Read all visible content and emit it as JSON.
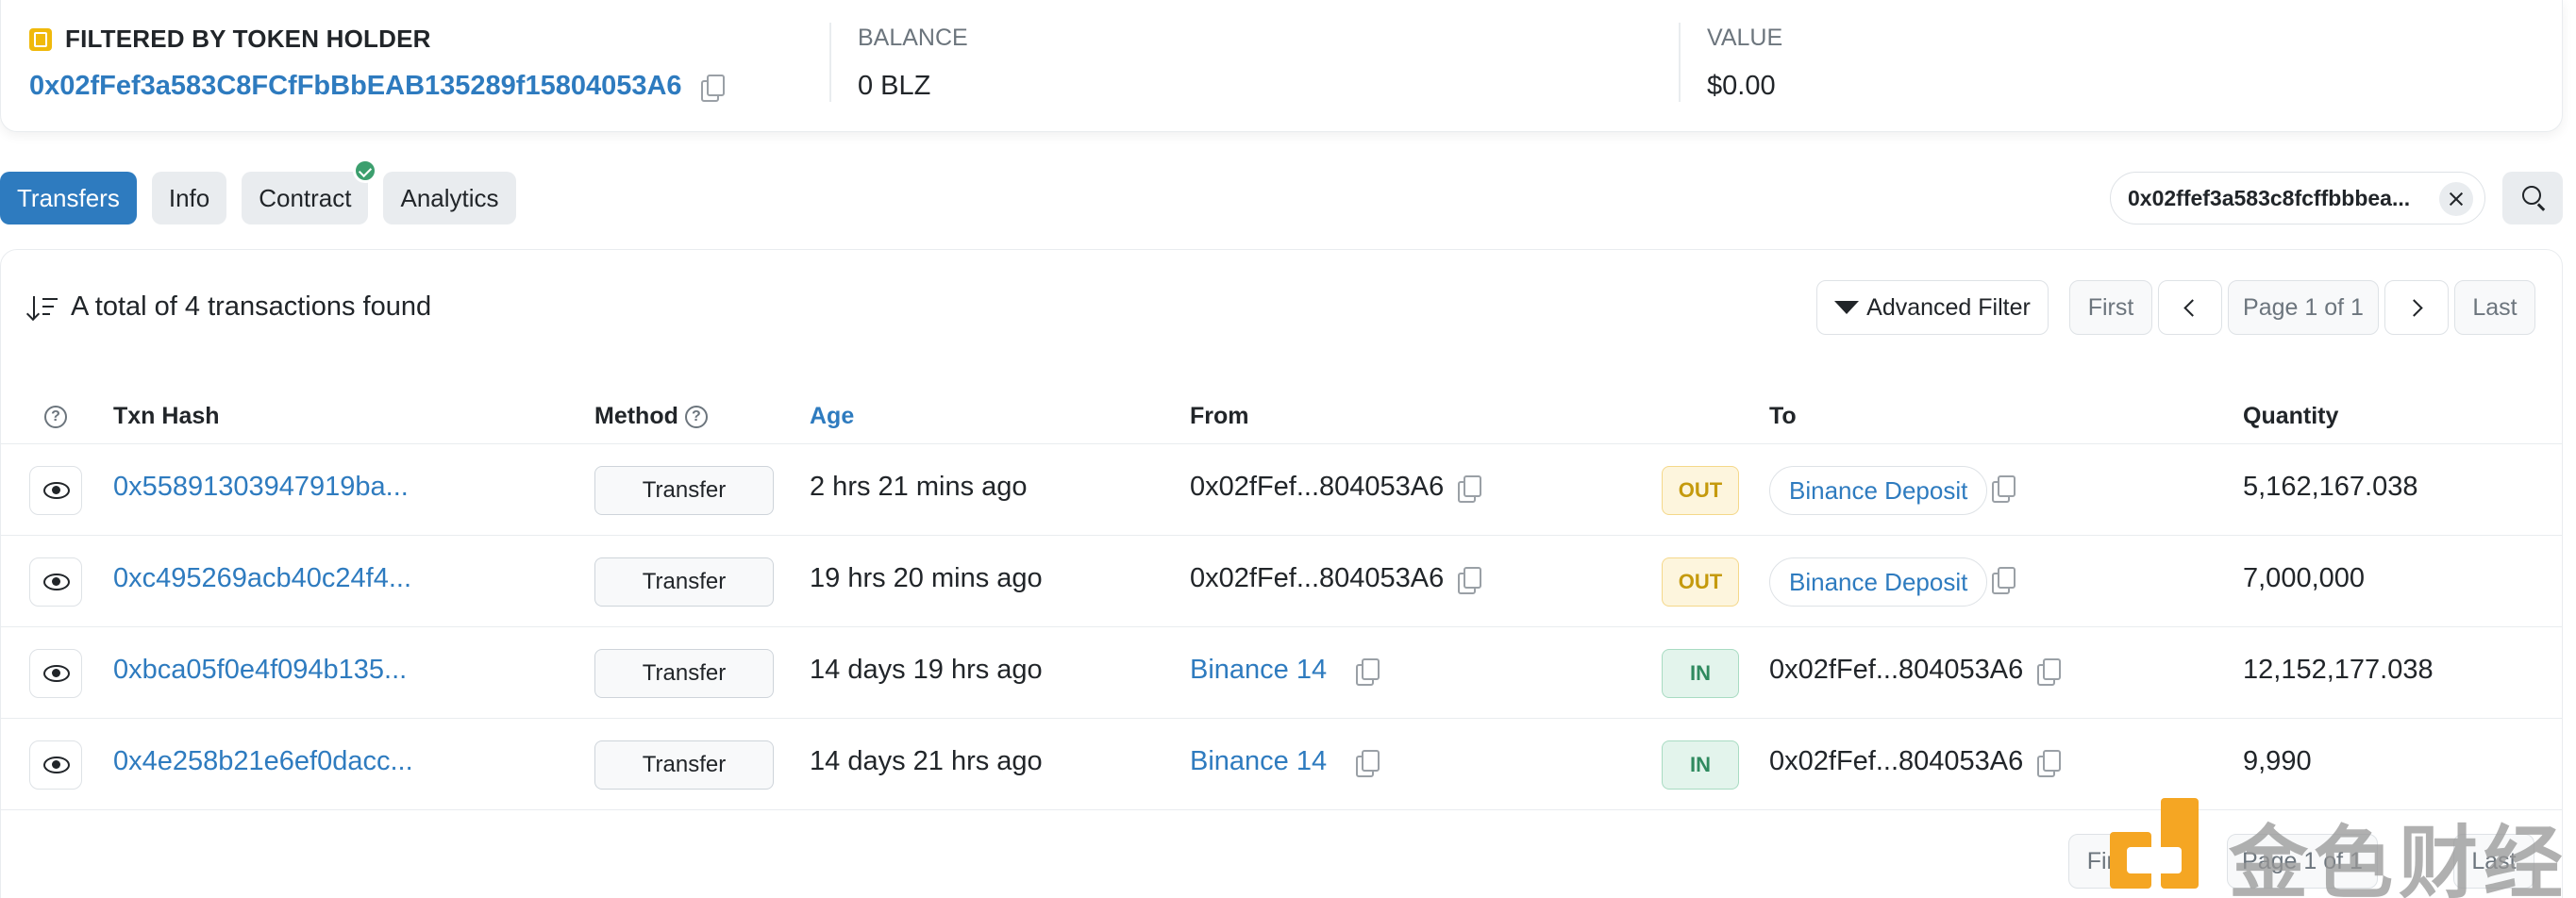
{
  "summary": {
    "holder_label": "FILTERED BY TOKEN HOLDER",
    "holder_address": "0x02fFef3a583C8FCfFbBbEAB135289f15804053A6",
    "balance_label": "BALANCE",
    "balance_value": "0 BLZ",
    "value_label": "VALUE",
    "value_value": "$0.00"
  },
  "tabs": [
    {
      "label": "Transfers",
      "active": true
    },
    {
      "label": "Info",
      "active": false
    },
    {
      "label": "Contract",
      "active": false
    },
    {
      "label": "Analytics",
      "active": false
    }
  ],
  "search_chip": {
    "text": "0x02ffef3a583c8fcffbbbea..."
  },
  "toolbar": {
    "total_text": "A total of 4 transactions found",
    "advanced_filter": "Advanced Filter",
    "first": "First",
    "page": "Page 1 of 1",
    "last": "Last"
  },
  "table": {
    "headers": {
      "help": "?",
      "txn_hash": "Txn Hash",
      "method": "Method",
      "age": "Age",
      "from": "From",
      "to": "To",
      "quantity": "Quantity"
    },
    "rows": [
      {
        "hash": "0x55891303947919ba...",
        "method": "Transfer",
        "age": "2 hrs 21 mins ago",
        "from": "0x02fFef...804053A6",
        "dir": "OUT",
        "to": "Binance Deposit",
        "quantity": "5,162,167.038"
      },
      {
        "hash": "0xc495269acb40c24f4...",
        "method": "Transfer",
        "age": "19 hrs 20 mins ago",
        "from": "0x02fFef...804053A6",
        "dir": "OUT",
        "to": "Binance Deposit",
        "quantity": "7,000,000"
      },
      {
        "hash": "0xbca05f0e4f094b135...",
        "method": "Transfer",
        "age": "14 days 19 hrs ago",
        "from": "Binance 14",
        "dir": "IN",
        "to": "0x02fFef...804053A6",
        "quantity": "12,152,177.038"
      },
      {
        "hash": "0x4e258b21e6ef0dacc...",
        "method": "Transfer",
        "age": "14 days 21 hrs ago",
        "from": "Binance 14",
        "dir": "IN",
        "to": "0x02fFef...804053A6",
        "quantity": "9,990"
      }
    ]
  },
  "bottom_pager": {
    "first": "First",
    "page": "Page 1 of 1",
    "last": "Last"
  },
  "watermark": {
    "text": "金色财经"
  },
  "colors": {
    "accent": "#2e7bbf",
    "out": "#c59a0d",
    "in": "#2f8a5f",
    "logo": "#f5a623"
  }
}
